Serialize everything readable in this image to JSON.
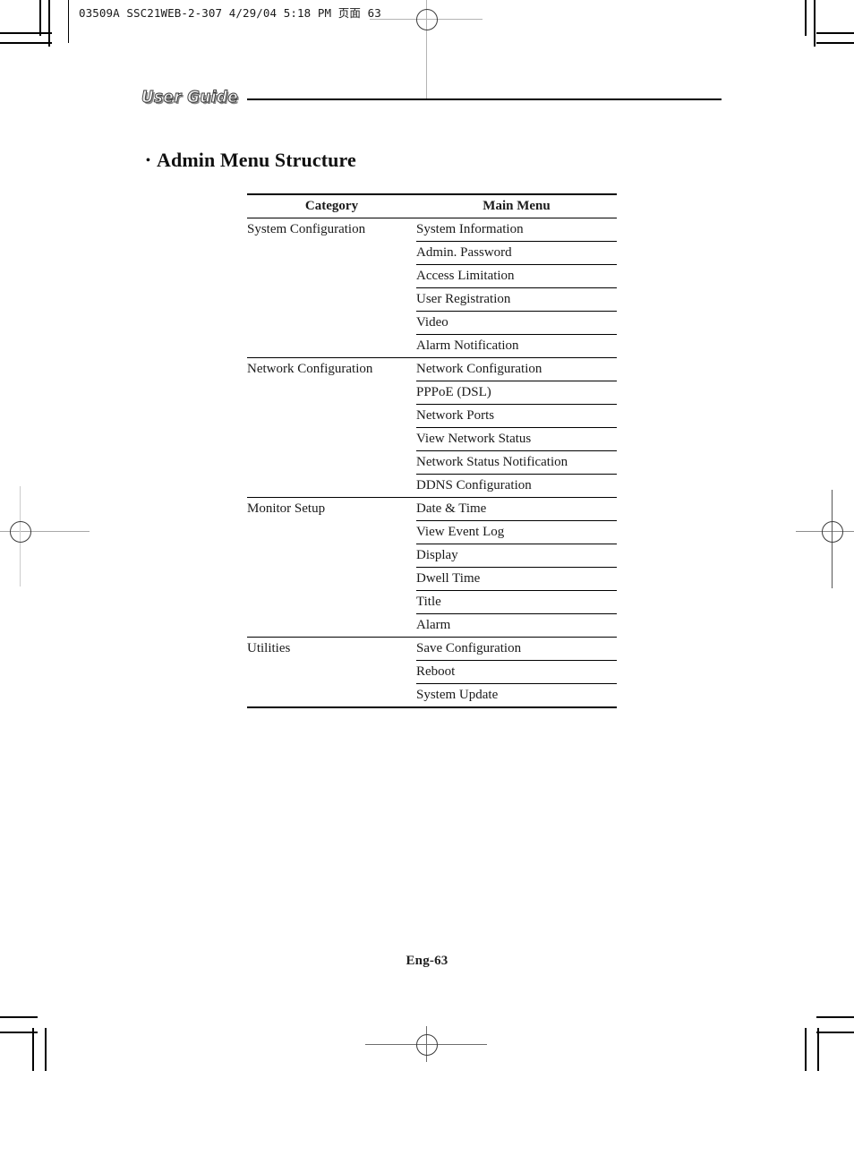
{
  "print_slug": {
    "text_prefix": "03509A SSC21WEB-2-307  4/29/04  5:18 PM ",
    "cjk": "页面",
    "page_number": " 63",
    "full": "03509A SSC21WEB-2-307  4/29/04  5:18 PM 页面 63"
  },
  "running_head": {
    "label": "User Guide"
  },
  "page": {
    "bullet": "•",
    "title": "Admin Menu Structure",
    "footer": "Eng-63"
  },
  "menu_table": {
    "headers": {
      "category": "Category",
      "main_menu": "Main Menu"
    },
    "sections": [
      {
        "category": "System Configuration",
        "items": [
          "System Information",
          "Admin. Password",
          "Access Limitation",
          "User Registration",
          "Video",
          "Alarm Notification"
        ]
      },
      {
        "category": "Network Configuration",
        "items": [
          "Network Configuration",
          "PPPoE (DSL)",
          "Network Ports",
          "View Network Status",
          "Network Status Notification",
          "DDNS Configuration"
        ]
      },
      {
        "category": "Monitor Setup",
        "items": [
          "Date & Time",
          "View Event Log",
          "Display",
          "Dwell Time",
          "Title",
          "Alarm"
        ]
      },
      {
        "category": "Utilities",
        "items": [
          "Save Configuration",
          "Reboot",
          "System Update"
        ]
      }
    ]
  },
  "colors": {
    "rule": "#000000",
    "text": "#1a1a1a",
    "registration": "#6e6e6e"
  }
}
